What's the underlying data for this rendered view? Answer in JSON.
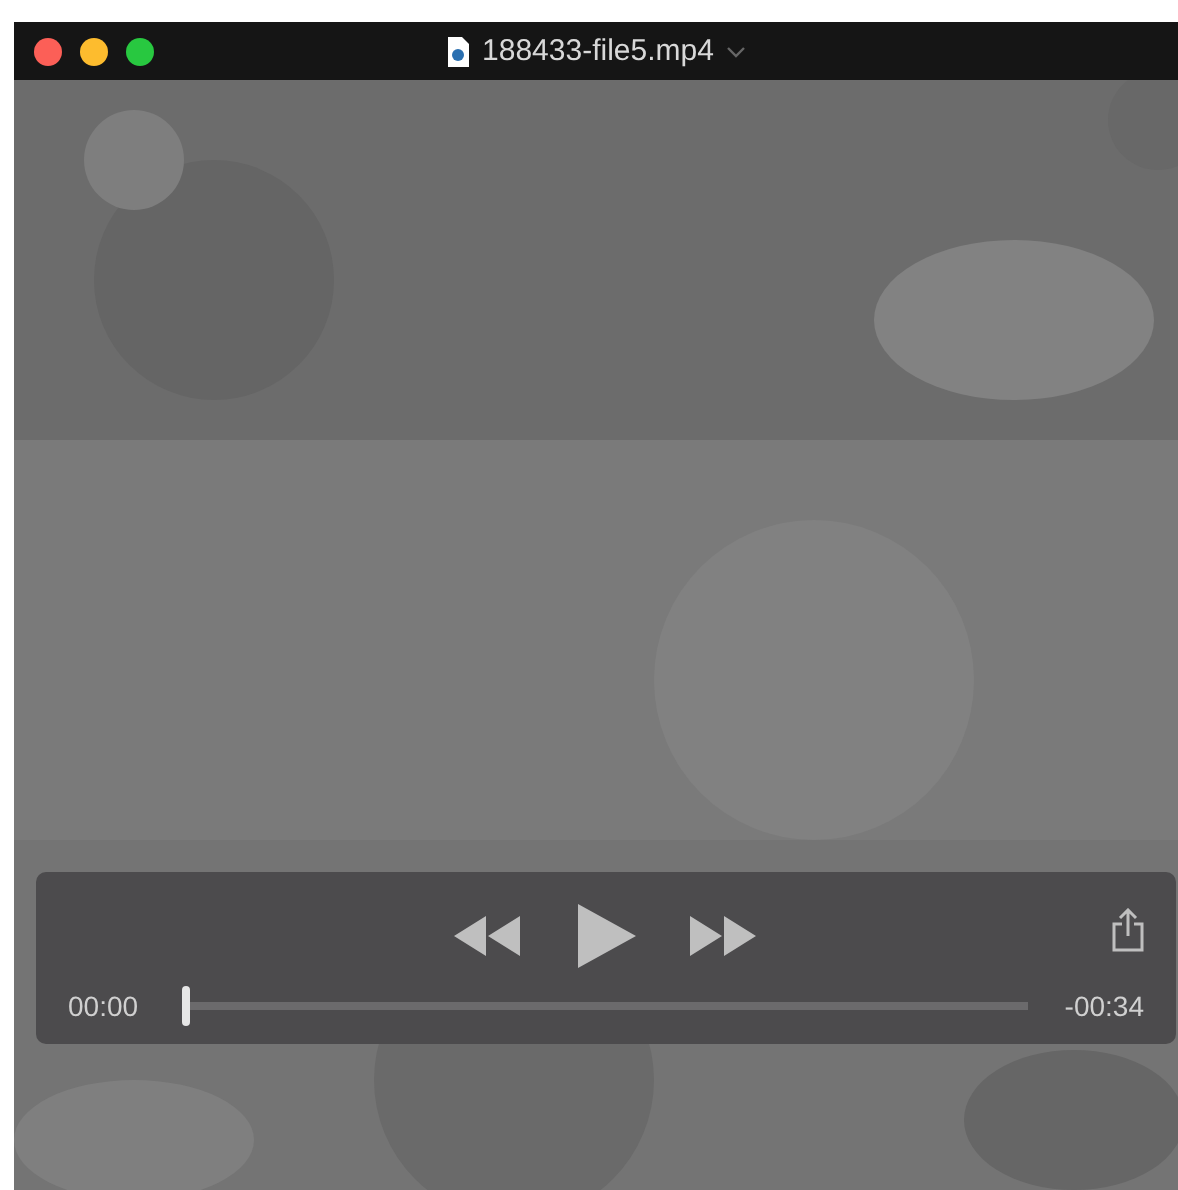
{
  "window": {
    "title": "188433-file5.mp4"
  },
  "player": {
    "elapsed": "00:00",
    "remaining": "-00:34",
    "level": 0
  }
}
